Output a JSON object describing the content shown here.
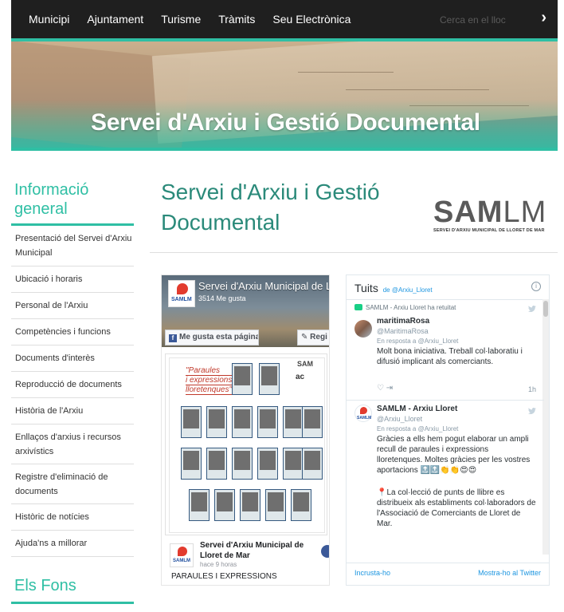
{
  "nav": {
    "items": [
      "Municipi",
      "Ajuntament",
      "Turisme",
      "Tràmits",
      "Seu Electrònica"
    ],
    "search_placeholder": "Cerca en el lloc",
    "go_label": "›"
  },
  "colors": {
    "accent": "#2fbfa4",
    "nav_bg": "#1f1f1f",
    "title": "#2b8a7a"
  },
  "hero": {
    "title": "Servei d'Arxiu i Gestió Documental"
  },
  "sidebar": {
    "heading": "Informació general",
    "items": [
      "Presentació del Servei d'Arxiu Municipal",
      "Ubicació i horaris",
      "Personal de l'Arxiu",
      "Competències i funcions",
      "Documents d'interès",
      "Reproducció de documents",
      "Història de l'Arxiu",
      "Enllaços d'arxius i recursos arxivístics",
      "Registre d'eliminació de documents",
      "Històric de notícies",
      "Ajuda'ns a millorar"
    ],
    "heading2": "Els Fons"
  },
  "main": {
    "title": "Servei d'Arxiu i Gestió Documental",
    "logo_text_bold": "SAM",
    "logo_text_light": "LM",
    "logo_sub": "SERVEI D'ARXIU MUNICIPAL DE LLORET DE MAR"
  },
  "facebook": {
    "page_name": "Servei d'Arxiu Municipal de L...",
    "likes": "3514 Me gusta",
    "like_button": "Me gusta esta página",
    "register_button": "Regi",
    "avatar_text": "SAMLM",
    "poster_title": [
      "\"Paraules",
      "i expressions",
      "lloretenques\""
    ],
    "poster_logo1": "SAM",
    "poster_logo2": "ac",
    "post_author": "Servei d'Arxiu Municipal de Lloret de Mar",
    "post_time": "hace 9 horas",
    "post_text": "PARAULES I EXPRESSIONS"
  },
  "twitter": {
    "title": "Tuits",
    "by": "de @Arxiu_Lloret",
    "info": "i",
    "tweets": [
      {
        "retweet": "SAMLM - Arxiu Lloret ha retuitat",
        "name": "maritimaRosa",
        "handle": "@MaritimaRosa",
        "reply": "En resposta a @Arxiu_Lloret",
        "text": "Molt bona iniciativa. Treball col·laboratiu i difusió implicant als comerciants.",
        "actions": "♡   ⇥",
        "time": "1h"
      },
      {
        "name": "SAMLM - Arxiu Lloret",
        "handle": "@Arxiu_Lloret",
        "reply": "En resposta a @Arxiu_Lloret",
        "text": "Gràcies a ells hem pogut elaborar un ampli recull de paraules i expressions lloretenques. Moltes gràcies per les vostres aportacions 🔝🔝👏👏😍😍",
        "text2": "📍La col·lecció de punts de llibre es distribueix als establiments col·laboradors de l'Associació de Comerciants de Lloret de Mar.",
        "avatar_text": "SAMLM"
      }
    ],
    "embed": "Incrusta-ho",
    "show_on": "Mostra-ho al Twitter"
  }
}
